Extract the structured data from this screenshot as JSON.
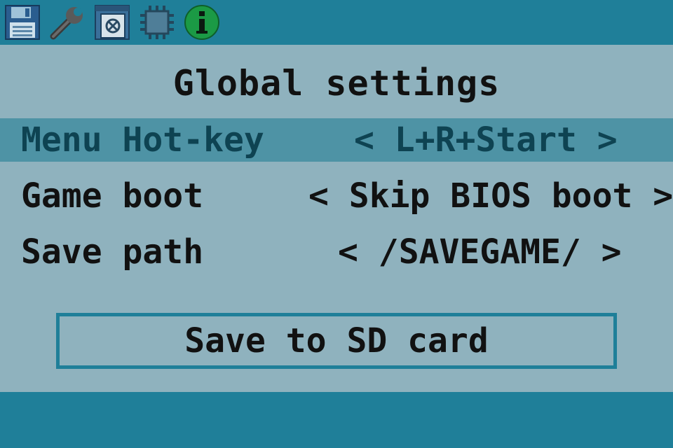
{
  "toolbar": {
    "icons": [
      "floppy-disk-icon",
      "wrench-icon",
      "window-gear-icon",
      "chip-icon",
      "info-icon"
    ]
  },
  "title": "Global settings",
  "settings": [
    {
      "label": "Menu Hot-key",
      "value": "< L+R+Start >",
      "selected": true
    },
    {
      "label": "Game boot",
      "value": "< Skip BIOS boot >",
      "selected": false
    },
    {
      "label": "Save path",
      "value": "< /SAVEGAME/ >",
      "selected": false
    }
  ],
  "save_button": "Save to SD card",
  "colors": {
    "background": "#8fb2be",
    "bar": "#1f7f99",
    "selected_row": "#4e93a5",
    "selected_text": "#0e4352",
    "info_green": "#1b9a45"
  }
}
